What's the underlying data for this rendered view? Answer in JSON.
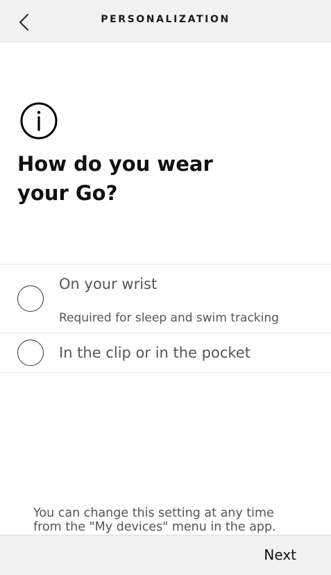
{
  "header": {
    "title": "PERSONALIZATION",
    "back_icon": "chevron-left-icon"
  },
  "main": {
    "icon": "info-circle-icon",
    "question_line1": "How do you wear",
    "question_line2": "your Go?",
    "options": [
      {
        "label": "On your wrist",
        "sublabel": "Required for sleep and swim tracking",
        "selected": false
      },
      {
        "label": "In the clip or in the pocket",
        "selected": false
      }
    ]
  },
  "footer": {
    "note_line1": "You can change this setting at any time",
    "note_line2": "from the \"My devices\" menu in the app.",
    "next_label": "Next"
  }
}
